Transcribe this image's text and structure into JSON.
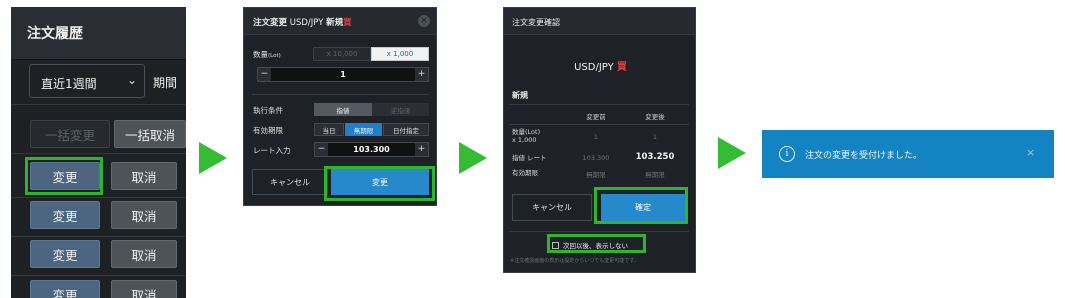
{
  "panel1": {
    "title": "注文履歴",
    "period_select": "直近1週間",
    "period_label": "期間",
    "bulk_change": "一括変更",
    "bulk_cancel": "一括取消",
    "rows": [
      {
        "change": "変更",
        "cancel": "取消"
      },
      {
        "change": "変更",
        "cancel": "取消"
      },
      {
        "change": "変更",
        "cancel": "取消"
      },
      {
        "change": "変更",
        "cancel": "取消"
      }
    ]
  },
  "panel2": {
    "header_title": "注文変更",
    "header_pair": "USD/JPY",
    "header_type": "新規",
    "header_side": "買",
    "qty_label": "数量",
    "qty_unit": "(Lot)",
    "qty_opt1": "x 10,000",
    "qty_opt2": "x 1,000",
    "qty_value": "1",
    "cond_label": "執行条件",
    "cond_opt1": "指値",
    "cond_opt2": "逆指値",
    "expiry_label": "有効期限",
    "expiry_opt1": "当日",
    "expiry_opt2": "無期限",
    "expiry_opt3": "日付指定",
    "rate_label": "レート入力",
    "rate_value": "103.300",
    "cancel": "キャンセル",
    "submit": "変更"
  },
  "panel3": {
    "header_title": "注文変更確認",
    "pair": "USD/JPY",
    "side": "買",
    "section": "新規",
    "col_before": "変更前",
    "col_after": "変更後",
    "row_qty_label1": "数量(Lot)",
    "row_qty_label2": "x 1,000",
    "qty_before": "1",
    "qty_after": "1",
    "row_rate_label": "指値 レート",
    "rate_before": "103.300",
    "rate_after": "103.250",
    "row_expiry_label": "有効期限",
    "expiry_before": "無期限",
    "expiry_after": "無期限",
    "cancel": "キャンセル",
    "confirm": "確定",
    "checkbox_label": "次回以後、表示しない",
    "note": "※注文確認画面の表示は設定からいつでも変更可能です。"
  },
  "panel4": {
    "info_icon": "i",
    "message": "注文の変更を受付けました。",
    "close": "×"
  },
  "colors": {
    "highlight": "#2fb52d",
    "arrow": "#34bd34",
    "sell_red": "#e2393b",
    "accent_blue": "#2589cc",
    "toast_blue": "#1483c1"
  }
}
